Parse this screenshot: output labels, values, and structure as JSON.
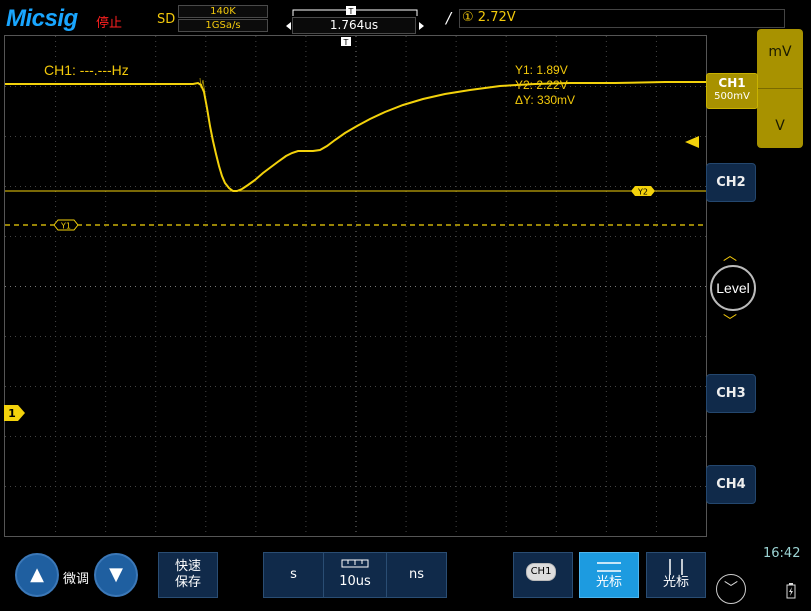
{
  "header": {
    "brand": "Micsig",
    "run_status": "停止",
    "acq_mode": "SD",
    "memory_depth": "140K",
    "sample_rate": "1GSa/s",
    "timebase_position": "1.764us",
    "trigger_level": "① 2.72V"
  },
  "display": {
    "frequency_readout": "CH1: ---.---Hz",
    "cursor_readout": {
      "y1": "Y1:  1.89V",
      "y2": "Y2:  2.22V",
      "dy": "ΔY:  330mV"
    },
    "markers": {
      "ch1": "1",
      "y1": "Y1",
      "y2": "Y2"
    }
  },
  "right_panel": {
    "ch1_label": "CH1",
    "ch1_scale": "500mV",
    "ch2_label": "CH2",
    "ch3_label": "CH3",
    "ch4_label": "CH4",
    "unit_mv": "mV",
    "unit_v": "V",
    "level_label": "Level"
  },
  "bottom_bar": {
    "fine_label": "微调",
    "quick_save_line1": "快速",
    "quick_save_line2": "保存",
    "time_s": "s",
    "time_value": "10us",
    "time_ns": "ns",
    "ch1_chip": "CH1",
    "cursor_h_label": "光标",
    "cursor_v_label": "光标",
    "clock": "16:42"
  },
  "colors": {
    "trace": "#f3d20b",
    "button_blue": "#102a4a",
    "active_blue": "#1d9be0",
    "ch1_yellow": "#a89200"
  }
}
